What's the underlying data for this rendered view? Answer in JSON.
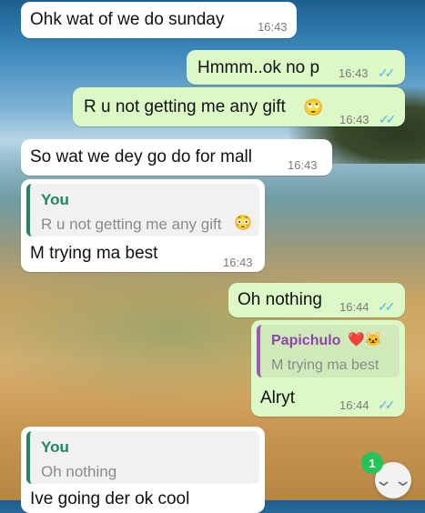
{
  "messages": [
    {
      "dir": "in",
      "text": "Ohk wat of we do sunday",
      "time": "16:43"
    },
    {
      "dir": "out",
      "text": "Hmmm..ok no p",
      "time": "16:43"
    },
    {
      "dir": "out",
      "text": "R u not getting me any gift",
      "emoji": "🙄",
      "time": "16:43"
    },
    {
      "dir": "in",
      "text": "So wat we dey go do for mall",
      "time": "16:43"
    },
    {
      "dir": "in",
      "reply_author": "You",
      "reply_text": "R u not getting me any gift",
      "reply_emoji": "😳",
      "text": "M trying ma best",
      "time": "16:43"
    },
    {
      "dir": "out",
      "text": "Oh nothing",
      "time": "16:44"
    },
    {
      "dir": "out",
      "reply_author": "Papichulo",
      "reply_author_emoji": "❤️🐱",
      "reply_text": "M trying ma best",
      "text": "Alryt",
      "time": "16:44"
    },
    {
      "dir": "in",
      "reply_author": "You",
      "reply_text": "Oh nothing",
      "text": "Ive going der ok cool"
    }
  ],
  "read_ticks": "✓✓",
  "scroll_button": {
    "icon": "chevron-down-icon",
    "glyph": "⌄⌄",
    "unread_count": "1"
  },
  "colors": {
    "incoming": "#ffffff",
    "outgoing": "#dcf8c6",
    "tick": "#4fb6ec",
    "reply_in_bar": "#21845f",
    "reply_out_bar": "#9b59b6",
    "badge": "#25c35b"
  }
}
